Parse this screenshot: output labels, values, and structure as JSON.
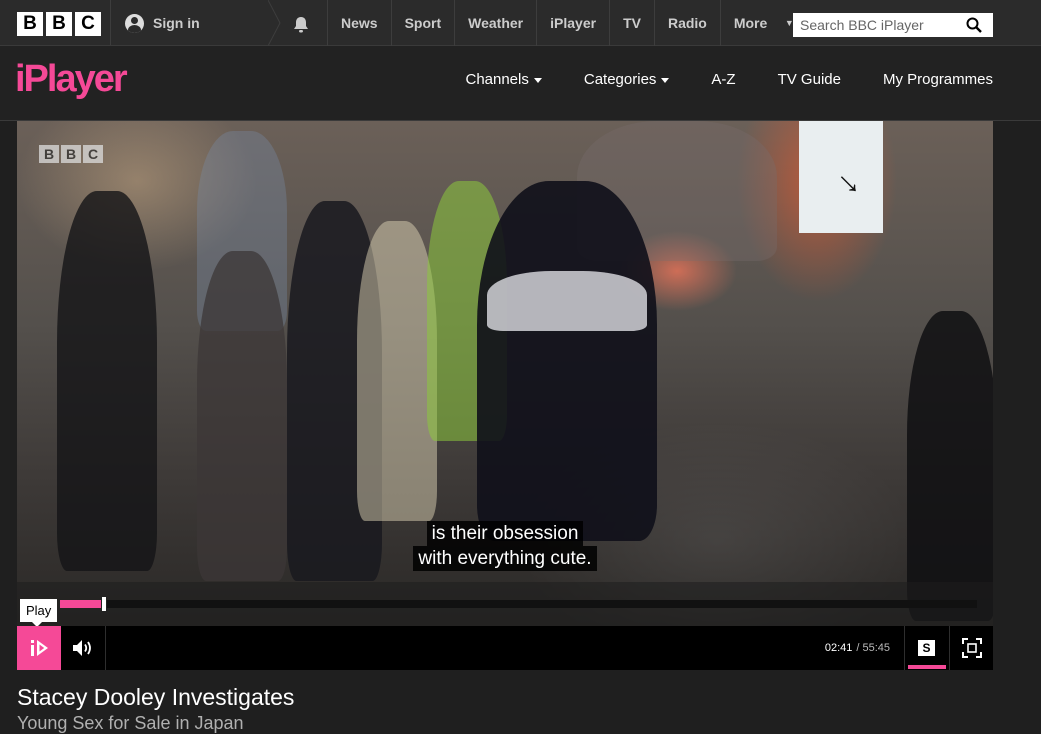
{
  "topbar": {
    "logo_letters": [
      "B",
      "B",
      "C"
    ],
    "signin_label": "Sign in",
    "nav": [
      "News",
      "Sport",
      "Weather",
      "iPlayer",
      "TV",
      "Radio",
      "More"
    ],
    "search_placeholder": "Search BBC iPlayer"
  },
  "iplayer": {
    "logo_text": "iPlayer",
    "brand_color": "#f54997",
    "nav": [
      {
        "label": "Channels",
        "dropdown": true
      },
      {
        "label": "Categories",
        "dropdown": true
      },
      {
        "label": "A-Z",
        "dropdown": false
      },
      {
        "label": "TV Guide",
        "dropdown": false
      },
      {
        "label": "My Programmes",
        "dropdown": false
      }
    ]
  },
  "player": {
    "watermark_letters": [
      "B",
      "B",
      "C"
    ],
    "subtitle_lines": [
      "is their obsession",
      "with everything cute."
    ],
    "tooltip": "Play",
    "current_time": "02:41",
    "total_time": "/ 55:45",
    "progress_fraction": 0.048,
    "subtitles_label": "S",
    "icons": {
      "play": "iplayer-play-icon",
      "volume": "volume-icon",
      "subtitles": "subtitles-icon",
      "fullscreen": "fullscreen-icon"
    }
  },
  "programme": {
    "title": "Stacey Dooley Investigates",
    "episode": "Young Sex for Sale in Japan"
  }
}
